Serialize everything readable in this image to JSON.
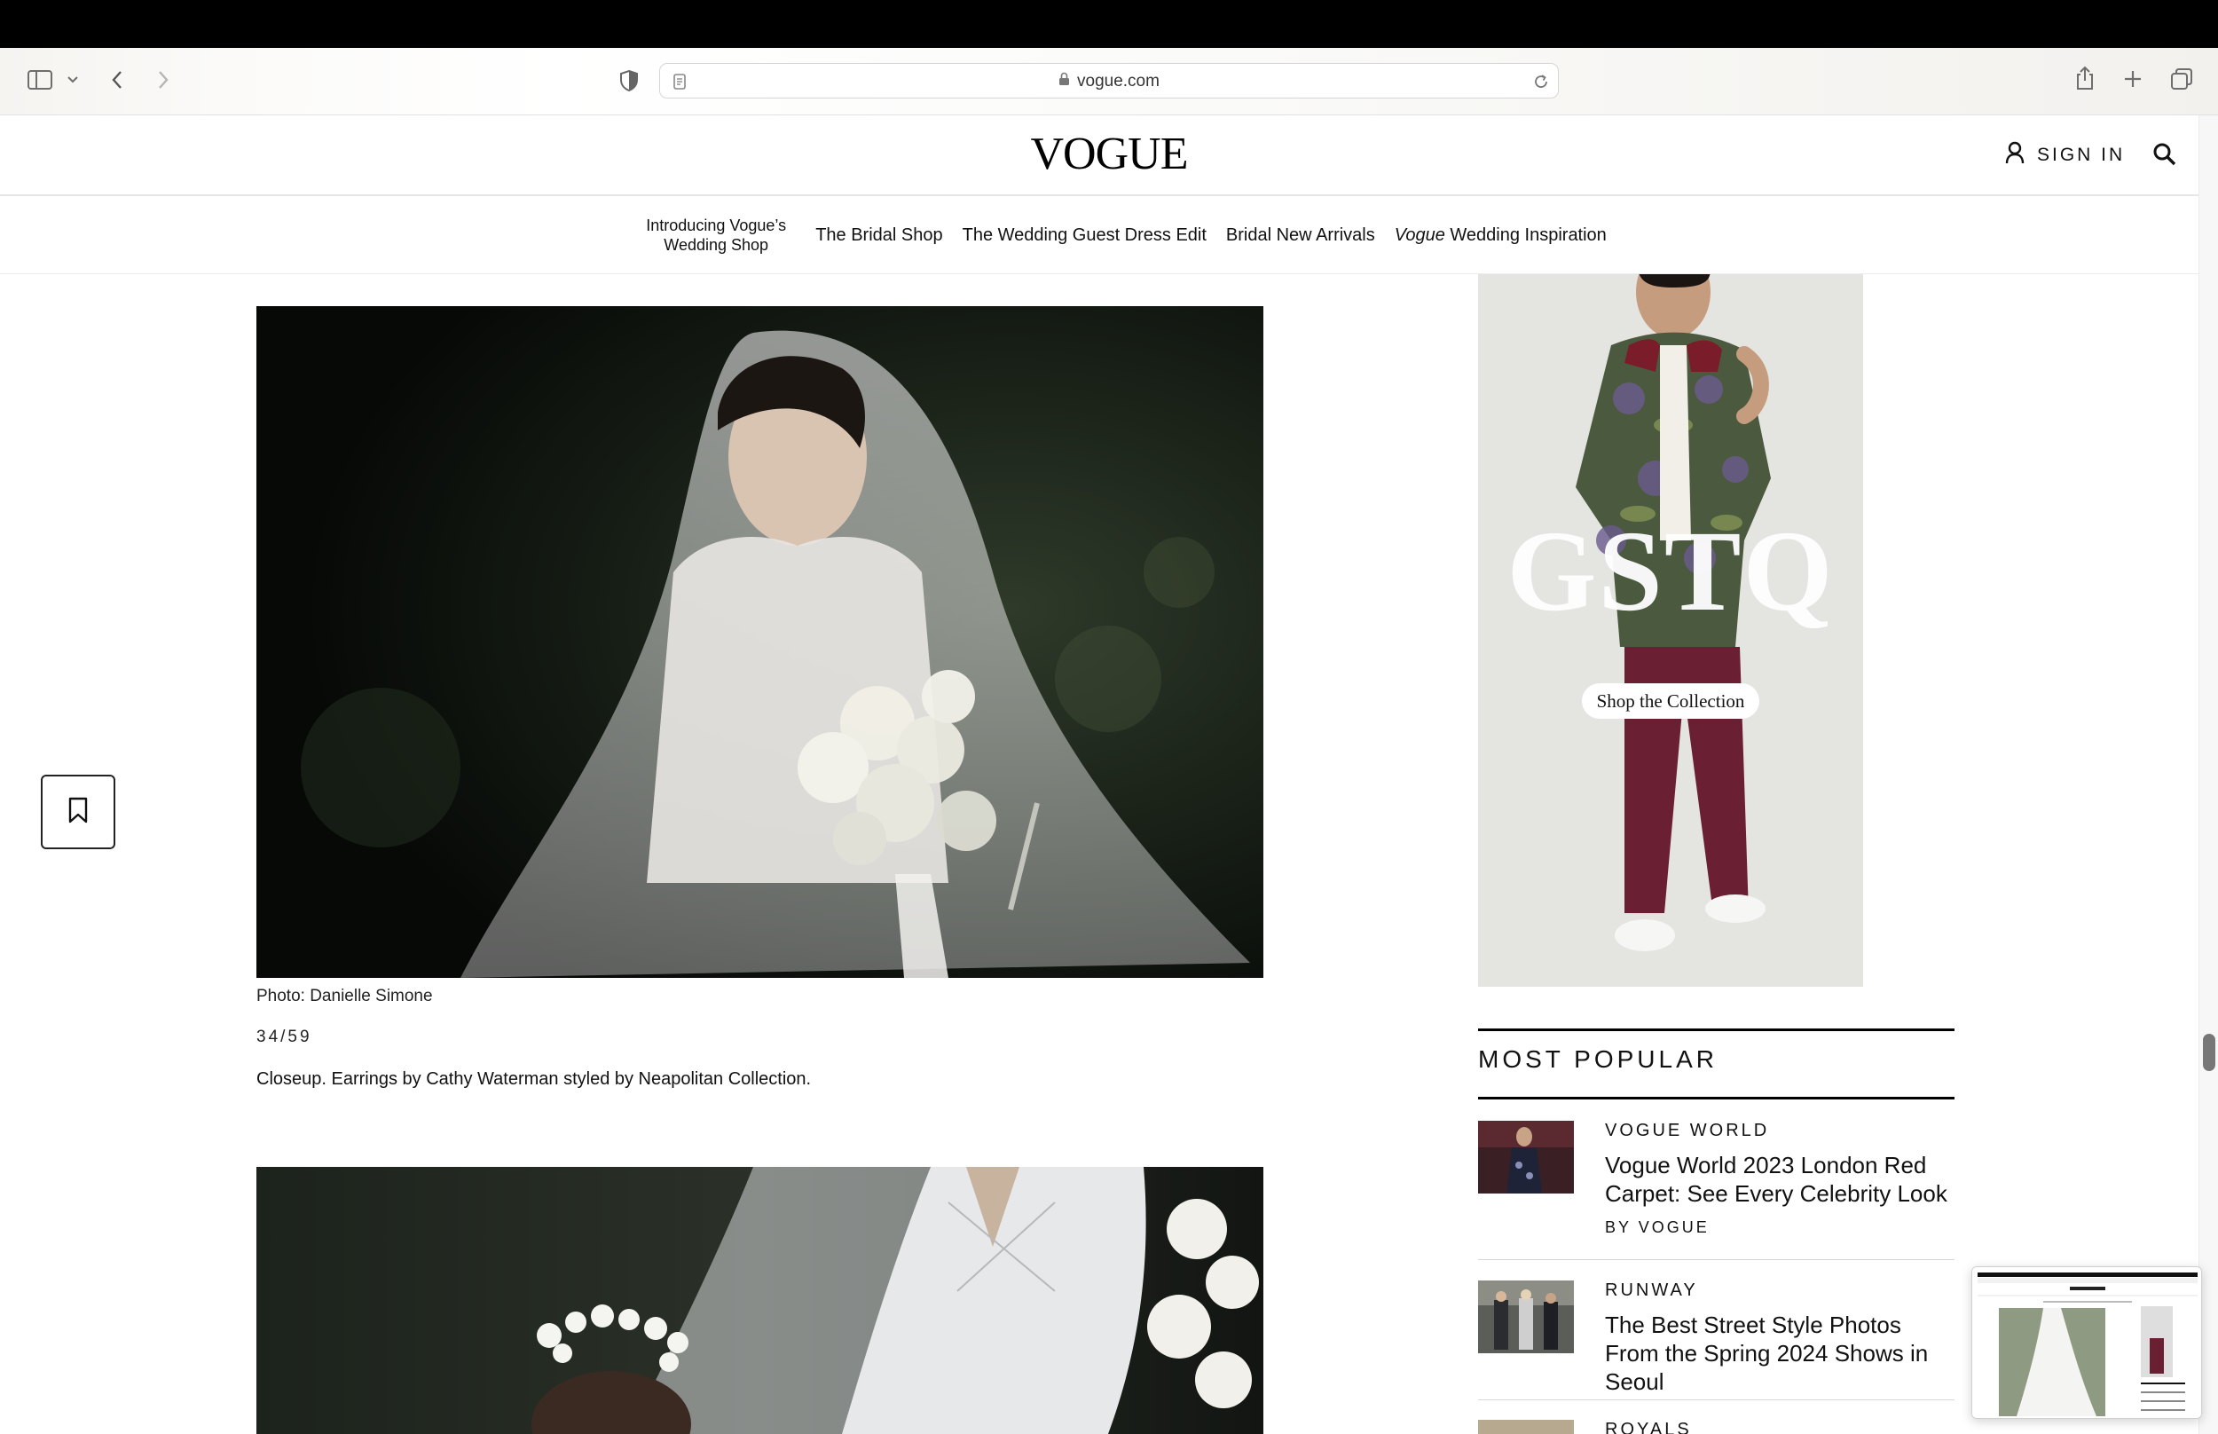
{
  "browser": {
    "url": "vogue.com"
  },
  "site": {
    "logo": "VOGUE",
    "sign_in": "SIGN IN"
  },
  "nav": {
    "item1": "Introducing Vogue’s Wedding Shop",
    "item2": "The Bridal Shop",
    "item3": "The Wedding Guest Dress Edit",
    "item4": "Bridal New Arrivals",
    "item5_em": "Vogue",
    "item5_rest": " Wedding Inspiration"
  },
  "gallery": {
    "credit": "Photo: Danielle Simone",
    "counter": "34/59",
    "caption": "Closeup. Earrings by Cathy Waterman styled by Neapolitan Collection."
  },
  "ad": {
    "brand": "GSTQ",
    "cta": "Shop the Collection"
  },
  "most_popular": {
    "title": "MOST POPULAR",
    "items": [
      {
        "category": "VOGUE WORLD",
        "headline": "Vogue World 2023 London Red Carpet: See Every Celebrity Look",
        "byline": "BY VOGUE"
      },
      {
        "category": "RUNWAY",
        "headline": "The Best Street Style Photos From the Spring 2024 Shows in Seoul"
      },
      {
        "category": "ROYALS"
      }
    ]
  },
  "colors": {
    "ad_pants": "#6b1f32",
    "ad_background": "#e4e4e1",
    "photo_background": "#0f130f"
  }
}
